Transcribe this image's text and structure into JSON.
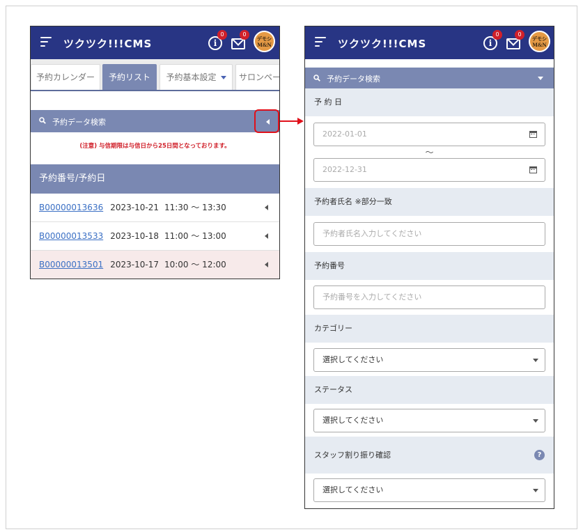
{
  "app": {
    "logo": "ツクツク!!!CMS",
    "info_badge": "0",
    "mail_badge": "0",
    "avatar_line1": "デモシ",
    "avatar_line2": "M&N"
  },
  "left_screen": {
    "tabs": [
      {
        "label": "予約カレンダー"
      },
      {
        "label": "予約リスト"
      },
      {
        "label": "予約基本設定"
      },
      {
        "label": "サロンペー"
      }
    ],
    "search_label": "予約データ検索",
    "notice": "(注意) 与信期限は与信日から25日間となっております。",
    "list_header": "予約番号/予約日",
    "reservations": [
      {
        "number": "B00000013636",
        "date": "2023-10-21",
        "time": "11:30 〜 13:30"
      },
      {
        "number": "B00000013533",
        "date": "2023-10-18",
        "time": "11:00 〜 13:00"
      },
      {
        "number": "B00000013501",
        "date": "2023-10-17",
        "time": "10:00 〜 12:00"
      }
    ]
  },
  "right_screen": {
    "search_label": "予約データ検索",
    "date_label": "予 約 日",
    "date_from": "2022-01-01",
    "date_to": "2022-12-31",
    "range_separator": "〜",
    "name_label": "予約者氏名 ※部分一致",
    "name_placeholder": "予約者氏名入力してください",
    "number_label": "予約番号",
    "number_placeholder": "予約番号を入力してください",
    "category_label": "カテゴリー",
    "category_value": "選択してください",
    "status_label": "ステータス",
    "status_value": "選択してください",
    "staff_label": "スタッフ割り振り確認",
    "staff_value": "選択してください",
    "help_glyph": "?"
  },
  "colors": {
    "header_bg": "#283584",
    "accent": "#7a88b2",
    "highlight_red": "#e0101a",
    "link": "#3a6fc4"
  }
}
